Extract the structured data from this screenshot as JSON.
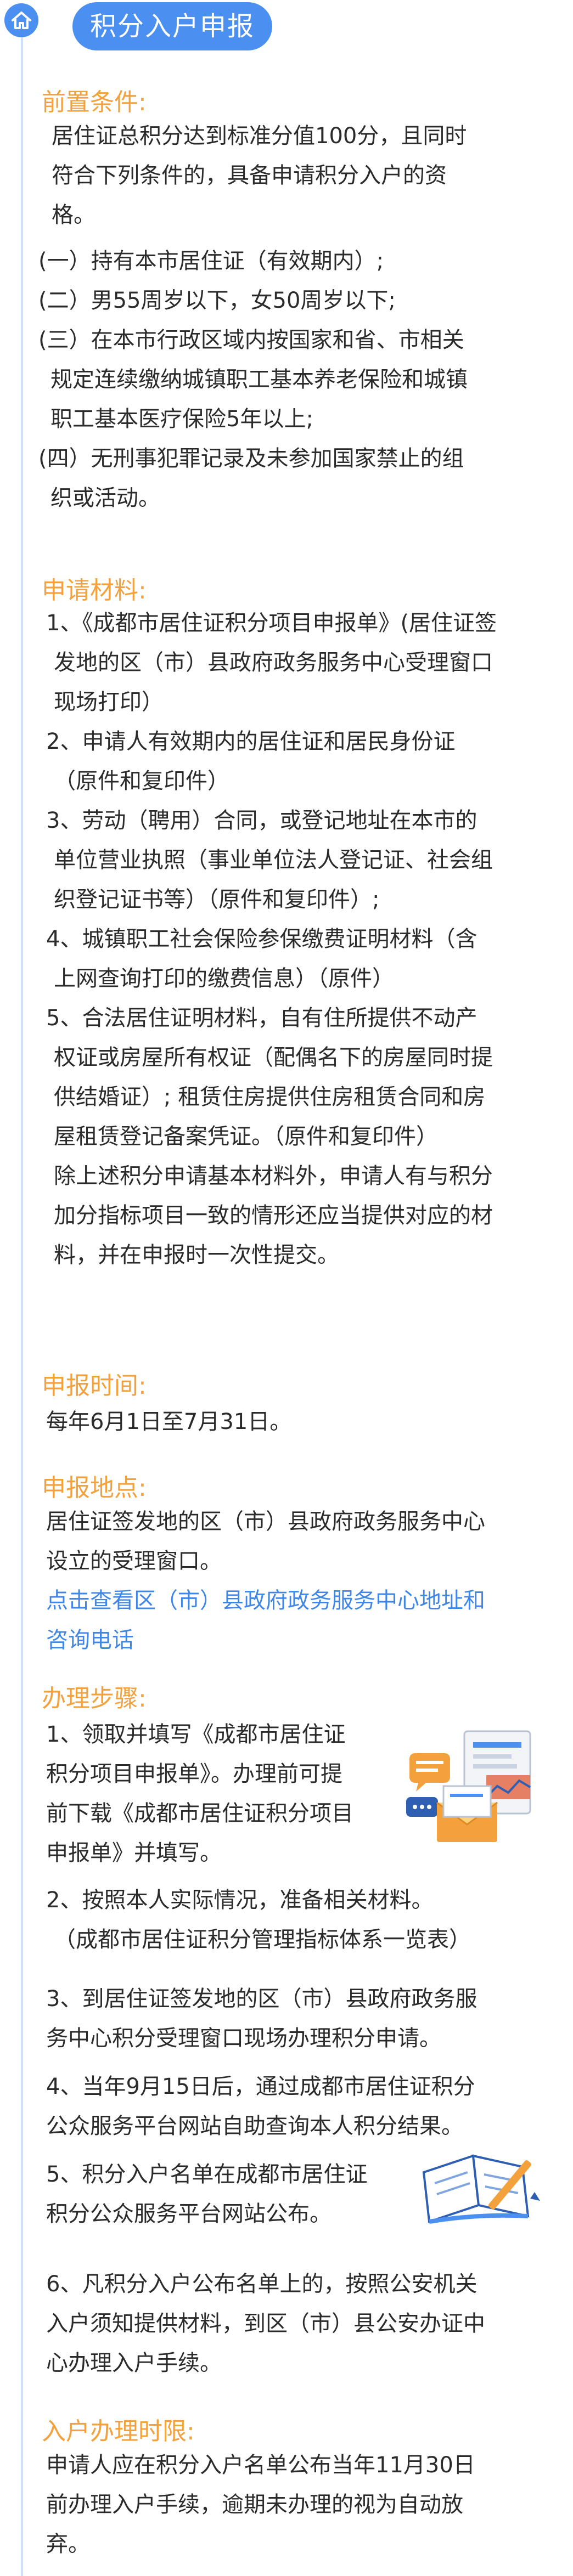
{
  "header": {
    "title": "积分入户申报",
    "home_icon": "home-icon",
    "accent": "#4b8ff0"
  },
  "colors": {
    "section_heading": "#f2a13c",
    "link": "#3f86e6",
    "rail": "#cfe2fb"
  },
  "sections": {
    "prereq": {
      "heading": "前置条件:",
      "intro": [
        "居住证总积分达到标准分值100分，且同时",
        "符合下列条件的，具备申请积分入户的资",
        "格。"
      ],
      "items": [
        [
          "(一）持有本市居住证（有效期内）;"
        ],
        [
          "(二）男55周岁以下，女50周岁以下;"
        ],
        [
          "(三）在本市行政区域内按国家和省、市相关",
          "规定连续缴纳城镇职工基本养老保险和城镇",
          "职工基本医疗保险5年以上;"
        ],
        [
          "(四）无刑事犯罪记录及未参加国家禁止的组",
          "织或活动。"
        ]
      ]
    },
    "materials": {
      "heading": "申请材料:",
      "items": [
        [
          "1、《成都市居住证积分项目申报单》(居住证签",
          "发地的区（市）县政府政务服务中心受理窗口",
          "现场打印）"
        ],
        [
          "2、申请人有效期内的居住证和居民身份证",
          "（原件和复印件）"
        ],
        [
          "3、劳动（聘用）合同，或登记地址在本市的",
          "单位营业执照（事业单位法人登记证、社会组",
          "织登记证书等）（原件和复印件）;"
        ],
        [
          "4、城镇职工社会保险参保缴费证明材料（含",
          "上网查询打印的缴费信息）（原件）"
        ],
        [
          "5、合法居住证明材料，自有住所提供不动产",
          "权证或房屋所有权证（配偶名下的房屋同时提",
          "供结婚证）; 租赁住房提供住房租赁合同和房",
          "屋租赁登记备案凭证。（原件和复印件）"
        ],
        [
          "除上述积分申请基本材料外，申请人有与积分",
          "加分指标项目一致的情形还应当提供对应的材",
          "料，并在申报时一次性提交。"
        ]
      ]
    },
    "time": {
      "heading": "申报时间:",
      "text": [
        "每年6月1日至7月31日。"
      ]
    },
    "place": {
      "heading": "申报地点:",
      "text": [
        "居住证签发地的区（市）县政府政务服务中心",
        "设立的受理窗口。"
      ],
      "link": [
        "点击查看区（市）县政府政务服务中心地址和",
        "咨询电话"
      ]
    },
    "steps": {
      "heading": "办理步骤:",
      "items": [
        [
          "1、领取并填写《成都市居住证",
          "积分项目申报单》。办理前可提",
          "前下载《成都市居住证积分项目",
          "申报单》并填写。"
        ],
        [
          "2、按照本人实际情况，准备相关材料。",
          "（成都市居住证积分管理指标体系一览表）"
        ],
        [
          "3、到居住证签发地的区（市）县政府政务服",
          "务中心积分受理窗口现场办理积分申请。"
        ],
        [
          "4、当年9月15日后，通过成都市居住证积分",
          "公众服务平台网站自助查询本人积分结果。"
        ],
        [
          "5、积分入户名单在成都市居住证",
          "积分公众服务平台网站公布。"
        ],
        [
          "6、凡积分入户公布名单上的，按照公安机关",
          "入户须知提供材料，到区（市）县公安办证中",
          "心办理入户手续。"
        ]
      ],
      "illus1_icon": "documents-chat-icon",
      "illus2_icon": "notebook-pen-icon"
    },
    "deadline": {
      "heading": "入户办理时限:",
      "text": [
        "申请人应在积分入户名单公布当年11月30日",
        "前办理入户手续，逾期未办理的视为自动放",
        "弃。"
      ]
    }
  }
}
